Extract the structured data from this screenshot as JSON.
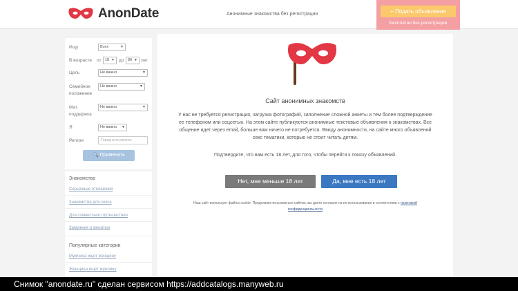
{
  "header": {
    "logo_text": "AnonDate",
    "tagline": "Анонимные знакомства без регистрации",
    "post_ad_label": "+ Подать объявление",
    "post_ad_sub": "Бесплатно без регистрации",
    "accent_color": "#e23744"
  },
  "filter": {
    "looking_label": "Ищу",
    "looking_value": "Всех",
    "age_label": "В возрасте",
    "age_from_label": "от",
    "age_from": "18",
    "age_to_label": "до",
    "age_to": "80",
    "age_unit": "лет",
    "goal_label": "Цель",
    "goal_value": "Не важно",
    "family_label_1": "Семейное",
    "family_label_2": "положение",
    "family_value": "Не важно",
    "support_label_1": "Мат.",
    "support_label_2": "поддержка",
    "support_value": "Не важно",
    "i_label": "Я",
    "i_value": "Не важно",
    "region_label": "Регион",
    "region_placeholder": "Город или регион",
    "apply_label": "Применить"
  },
  "sidebar": {
    "dating_title": "Знакомства",
    "dating_links": [
      "Серьезные отношения",
      "Знакомства для секса",
      "Для совместного путешествия",
      "Замужние и женатые"
    ],
    "popular_title": "Популярные категории",
    "popular_links": [
      "Мужчина ищет женщину",
      "Женщина ищет мужчину"
    ]
  },
  "main": {
    "title": "Сайт анонимных знакомств",
    "desc_1": "У нас не требуется регистрация, загрузка фотографий, заполнение сложной анкеты и тем более подтверждение",
    "desc_2": "ее телефоном или соцсетью. На этом сайте публикуются анонимные текстовые объявления о знакомствах. Все",
    "desc_3": "общение идет через email, больше вам ничего не потребуется. Ввиду анонимности, на сайте много объявлений",
    "desc_4": "секс тематики, которые не стоит читать детям.",
    "confirm_text": "Подтвердите, что вам есть 18 лет, для того, чтобы перейти к поиску объявлений.",
    "btn_no": "Нет, мне меньше 18 лет",
    "btn_yes": "Да, мне есть 18 лет",
    "cookie_text": "Наш сайт использует файлы cookie. Продолжая пользоваться сайтом, вы даете согласие на их использование в соответствии с",
    "cookie_link_1": "политикой",
    "cookie_link_2": "конфиденциальности"
  },
  "capture": {
    "text": "Снимок \"anondate.ru\" сделан сервисом https://addcatalogs.manyweb.ru"
  }
}
